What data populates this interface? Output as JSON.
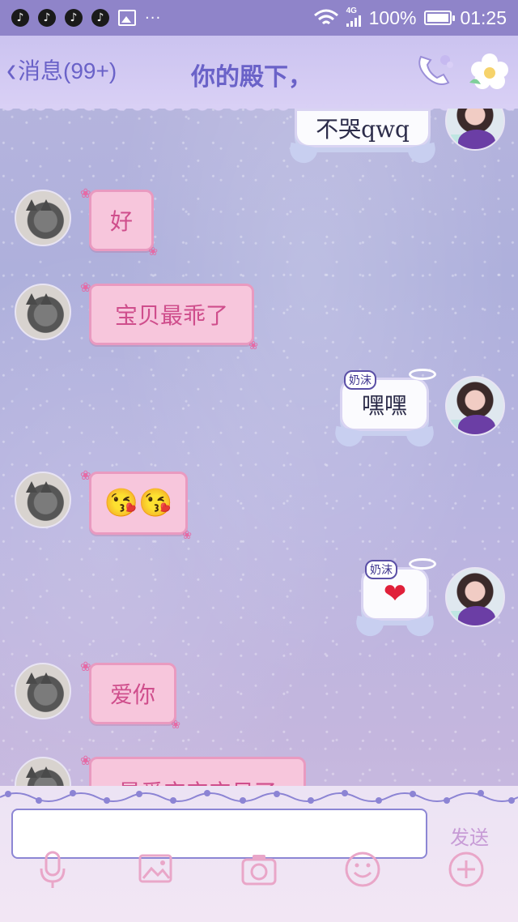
{
  "status_bar": {
    "tiktok_icons": [
      "♪",
      "♪",
      "♪",
      "♪"
    ],
    "more": "···",
    "network": "4G",
    "battery_percent": "100%",
    "battery_level": 1.0,
    "time": "01:25"
  },
  "header": {
    "back_label": "消息(99+)",
    "title": "你的殿下，"
  },
  "messages": [
    {
      "side": "right",
      "text": "不哭qwq"
    },
    {
      "side": "left",
      "text": "好"
    },
    {
      "side": "left",
      "text": "宝贝最乖了"
    },
    {
      "side": "right",
      "tag": "奶沫",
      "text": "嘿嘿"
    },
    {
      "side": "left",
      "text": "😘😘"
    },
    {
      "side": "right",
      "tag": "奶沫",
      "text": "❤"
    },
    {
      "side": "left",
      "text": "爱你"
    },
    {
      "side": "left",
      "text": "最爱宝宝宝贝了"
    }
  ],
  "input": {
    "placeholder": "",
    "send_label": "发送"
  },
  "colors": {
    "accent": "#6a62c8",
    "bubble_pink": "#f7c6dc",
    "bubble_pink_text": "#cf4e8c"
  },
  "toolbar": [
    "microphone-icon",
    "image-icon",
    "camera-icon",
    "emoji-icon",
    "plus-icon"
  ]
}
